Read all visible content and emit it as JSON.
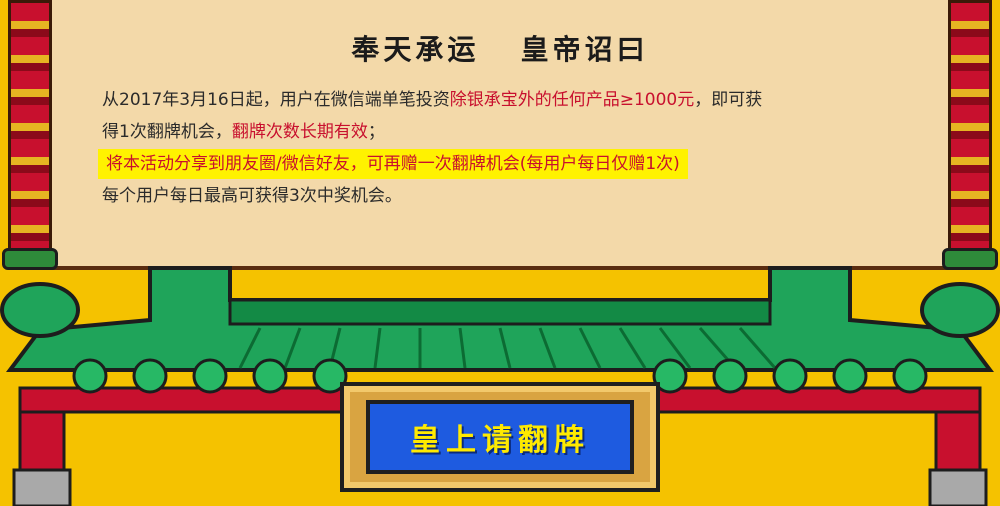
{
  "header": {
    "title": "奉天承运   皇帝诏曰"
  },
  "rules": {
    "line1_prefix": "从2017年3月16日起，用户在微信端单笔投资",
    "line1_red": "除银承宝外的任何产品≥1000元",
    "line1_suffix": "，即可获",
    "line2_prefix": "得1次翻牌机会，",
    "line2_red": "翻牌次数长期有效",
    "line2_suffix": "；",
    "line3_highlight": "将本活动分享到朋友圈/微信好友，可再赠一次翻牌机会(每用户每日仅赠1次)",
    "line4": "每个用户每日最高可获得3次中奖机会。"
  },
  "action": {
    "flip_button_label": "皇上请翻牌"
  },
  "colors": {
    "background": "#f5c200",
    "paper": "#f3d9a9",
    "roof_green": "#1fa45a",
    "beam_red": "#c8102e",
    "button_blue": "#1e5be0",
    "button_text": "#ffea00",
    "highlight": "#fff200"
  },
  "icons": {
    "left_pillar": "dragon-pillar-icon",
    "right_pillar": "dragon-pillar-icon",
    "roof": "palace-roof-icon"
  }
}
